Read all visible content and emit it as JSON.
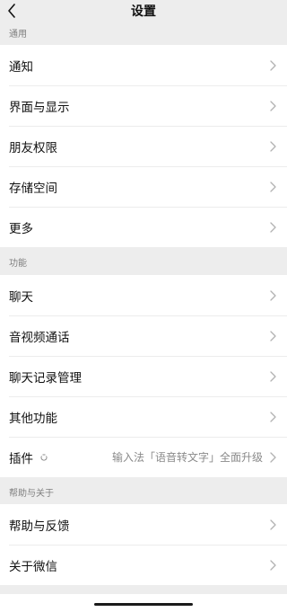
{
  "header": {
    "title": "设置",
    "back_icon": "chevron-left-icon"
  },
  "sections": {
    "general": {
      "header": "通用",
      "items": [
        {
          "label": "通知"
        },
        {
          "label": "界面与显示"
        },
        {
          "label": "朋友权限"
        },
        {
          "label": "存储空间"
        },
        {
          "label": "更多"
        }
      ]
    },
    "features": {
      "header": "功能",
      "items": [
        {
          "label": "聊天"
        },
        {
          "label": "音视频通话"
        },
        {
          "label": "聊天记录管理"
        },
        {
          "label": "其他功能"
        },
        {
          "label": "插件",
          "value": "输入法「语音转文字」全面升级",
          "badge_icon": "plugin-badge-icon"
        }
      ]
    },
    "help": {
      "header": "帮助与关于",
      "items": [
        {
          "label": "帮助与反馈"
        },
        {
          "label": "关于微信"
        }
      ]
    }
  },
  "icons": {
    "row_arrow": "chevron-right-icon"
  },
  "colors": {
    "background": "#ededed",
    "card": "#ffffff",
    "section_text": "#7f7f7f",
    "value_text": "#8a8a8a",
    "chevron": "#b2b2b2"
  }
}
